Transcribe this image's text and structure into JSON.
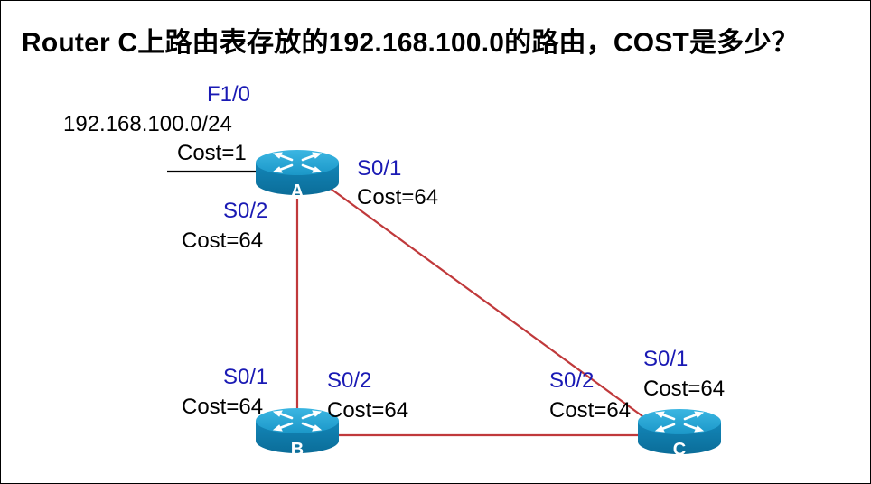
{
  "title": "Router C上路由表存放的192.168.100.0的路由，COST是多少？",
  "colors": {
    "link": "#c0393b",
    "interface_label": "#1a1ab4",
    "router_body": "#0f84b3",
    "router_top": "#1fa3d4"
  },
  "routers": [
    {
      "label": "A"
    },
    {
      "label": "B"
    },
    {
      "label": "C"
    }
  ],
  "network": {
    "interface": "F1/0",
    "address": "192.168.100.0/24",
    "cost": "Cost=1"
  },
  "interfaces": {
    "a_s01": {
      "name": "S0/1",
      "cost": "Cost=64"
    },
    "a_s02": {
      "name": "S0/2",
      "cost": "Cost=64"
    },
    "b_s01": {
      "name": "S0/1",
      "cost": "Cost=64"
    },
    "b_s02": {
      "name": "S0/2",
      "cost": "Cost=64"
    },
    "c_s02": {
      "name": "S0/2",
      "cost": "Cost=64"
    },
    "c_s01": {
      "name": "S0/1",
      "cost": "Cost=64"
    }
  }
}
